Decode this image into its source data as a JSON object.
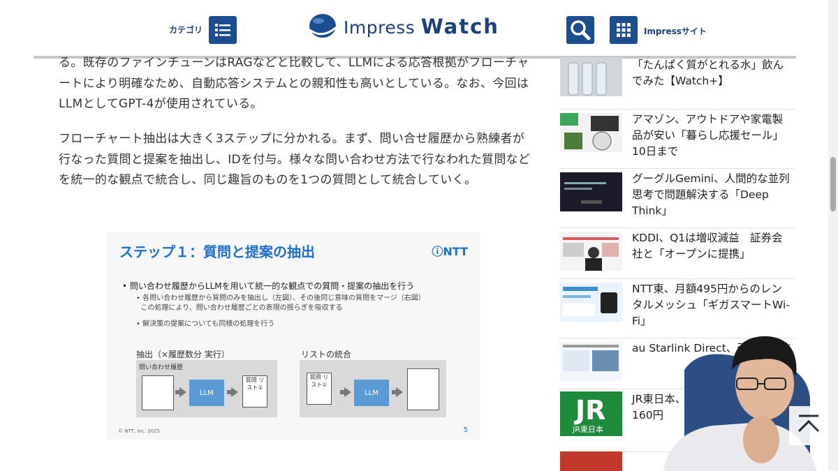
{
  "header": {
    "category_label": "カテゴリ",
    "logo_text_1": "Impress",
    "logo_text_2": "Watch",
    "impress_sites_label": "Impressサイト",
    "colors": {
      "brand": "#1c4e8f"
    }
  },
  "article": {
    "paragraphs": [
      "る。既存のファインチューンはRAGなどと比較して、LLMによる応答根拠がフローチャートにより明確なため、自動応答システムとの親和性も高いとしている。なお、今回はLLMとしてGPT-4が使用されている。",
      "フローチャート抽出は大きく3ステップに分かれる。まず、問い合せ履歴から熟練者が行なった質問と提案を抽出し、IDを付与。様々な問い合わせ方法で行なわれた質問などを統一的な観点で統合し、同じ趣旨のものを1つの質問として統合していく。"
    ],
    "slide": {
      "title": "ステップ１：質問と提案の抽出",
      "brand": "ⓘNTT",
      "bullet_main": "問い合わせ履歴からLLMを用いて統一的な観点での質問・提案の抽出を行う",
      "bullet_sub_1a": "各問い合わせ履歴から質問のみを抽出し（左図）、その後同じ意味の質問をマージ（右図）",
      "bullet_sub_1b": "この処理により、問い合わせ履歴ごとの表現の揺らぎを吸収する",
      "bullet_sub_2": "解決策の提案についても同様の処理を行う",
      "left_panel_label": "抽出（×履歴数分 実行）",
      "left_panel_caption": "問い合わせ履歴",
      "llm_label": "LLM",
      "left_output_doc": "質問 リスト①",
      "right_panel_label": "リストの統合",
      "right_input_doc": "質問 リスト①",
      "footer": "© NTT, Inc. 2025",
      "page_number": "5"
    }
  },
  "sidebar": {
    "items": [
      {
        "title": "「たんぱく質がとれる水」飲んでみた【Watch+】"
      },
      {
        "title": "アマゾン、アウトドアや家電製品が安い「暮らし応援セール」　10日まで"
      },
      {
        "title": "グーグルGemini、人間的な並列思考で問題解決する「Deep Think」"
      },
      {
        "title": "KDDI、Q1は増収減益　証券会社と「オープンに提携」"
      },
      {
        "title": "NTT東、月額495円からのレンタルメッシュ「ギガスマートWi-Fi」"
      },
      {
        "title": "au Starlink Direct、画の送受信"
      },
      {
        "title": "JR東日本、7.1%の運賃値上げ160円"
      }
    ],
    "thumb_text_jr": "JR東日本"
  }
}
